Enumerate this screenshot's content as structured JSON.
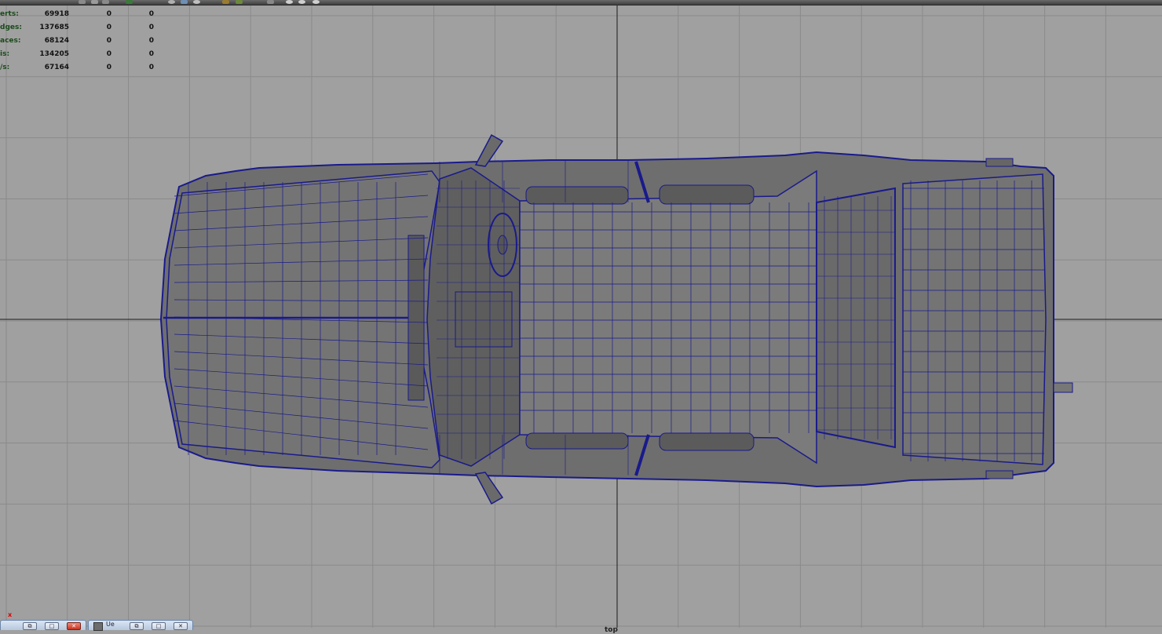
{
  "toolbar": {
    "icons": [
      "shelf-tool-icon",
      "shelf-tool-icon",
      "shelf-tool-icon",
      "render-icon",
      "sphere-icon",
      "sphere-icon",
      "camera-icon",
      "settings-icon"
    ]
  },
  "hud": {
    "rows": [
      {
        "label": "erts:",
        "values": [
          "69918",
          "0",
          "0"
        ]
      },
      {
        "label": "dges:",
        "values": [
          "137685",
          "0",
          "0"
        ]
      },
      {
        "label": "aces:",
        "values": [
          "68124",
          "0",
          "0"
        ]
      },
      {
        "label": "is:",
        "values": [
          "134205",
          "0",
          "0"
        ]
      },
      {
        "label": "/s:",
        "values": [
          "67164",
          "0",
          "0"
        ]
      }
    ]
  },
  "viewport": {
    "camera": "top",
    "background_color": "#a0a0a0",
    "grid_color": "#8a8a8a",
    "axis_color": "#1a1a1a",
    "wire_color": "#1a1a8c",
    "mesh_fill": "#6e6e6e"
  },
  "bottom_panels": {
    "close_marker": "x",
    "panel_1": {
      "buttons": [
        "⧉",
        "□",
        "✕"
      ]
    },
    "panel_2": {
      "label": "Ue",
      "buttons": [
        "⧉",
        "□",
        "✕"
      ]
    }
  }
}
